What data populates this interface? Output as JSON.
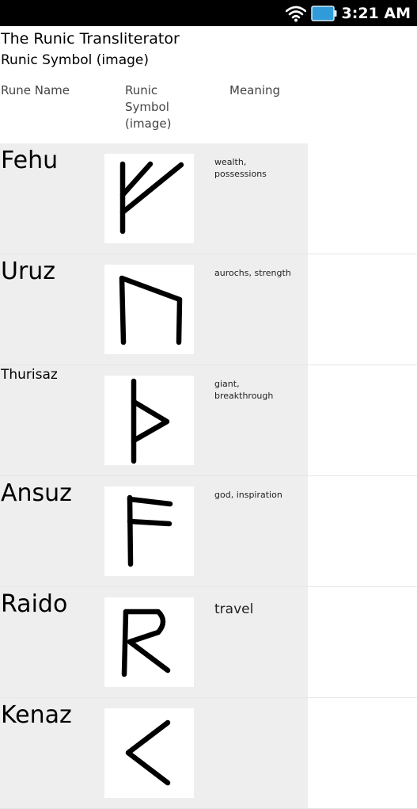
{
  "status_bar": {
    "time": "3:21 AM",
    "icons": [
      "wifi-icon",
      "battery-icon"
    ],
    "battery_color": "#2f9bd8"
  },
  "header": {
    "title": "The Runic Transliterator",
    "subtitle": "Runic Symbol (image)"
  },
  "columns": {
    "name": "Rune Name",
    "symbol": "Runic Symbol (image)",
    "meaning": "Meaning"
  },
  "runes": [
    {
      "name": "Fehu",
      "meaning": "wealth, possessions",
      "glyph": "fehu-rune-icon"
    },
    {
      "name": "Uruz",
      "meaning": "aurochs, strength",
      "glyph": "uruz-rune-icon"
    },
    {
      "name": "Thurisaz",
      "meaning": "giant, breakthrough",
      "glyph": "thurisaz-rune-icon"
    },
    {
      "name": "Ansuz",
      "meaning": "god, inspiration",
      "glyph": "ansuz-rune-icon"
    },
    {
      "name": "Raido",
      "meaning": "travel",
      "glyph": "raido-rune-icon"
    },
    {
      "name": "Kenaz",
      "meaning": "",
      "glyph": "kenaz-rune-icon"
    }
  ],
  "colors": {
    "row_background": "#eeeeee",
    "status_bar": "#000000"
  }
}
